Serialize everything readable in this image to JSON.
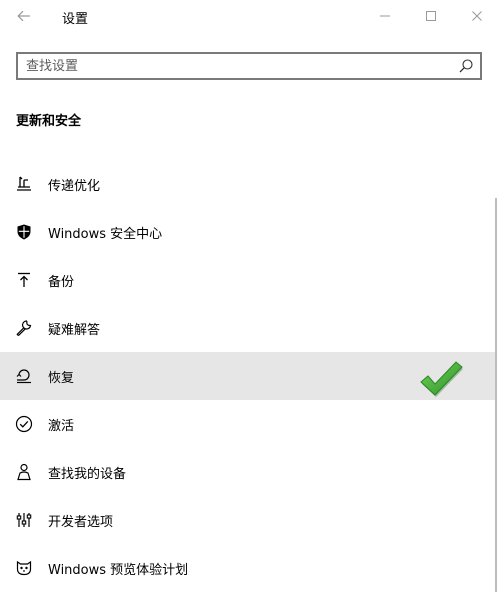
{
  "window": {
    "title": "设置"
  },
  "search": {
    "placeholder": "查找设置",
    "value": ""
  },
  "section": {
    "heading": "更新和安全"
  },
  "nav": {
    "items": [
      {
        "label": "传递优化",
        "icon": "delivery-optimization-icon"
      },
      {
        "label": "Windows 安全中心",
        "icon": "shield-icon"
      },
      {
        "label": "备份",
        "icon": "backup-upload-icon"
      },
      {
        "label": "疑难解答",
        "icon": "wrench-icon"
      },
      {
        "label": "恢复",
        "icon": "recovery-icon",
        "selected": true
      },
      {
        "label": "激活",
        "icon": "check-circle-icon"
      },
      {
        "label": "查找我的设备",
        "icon": "person-location-icon"
      },
      {
        "label": "开发者选项",
        "icon": "developer-tools-icon"
      },
      {
        "label": "Windows 预览体验计划",
        "icon": "insider-cat-icon"
      }
    ]
  },
  "colors": {
    "selected_bg": "#e6e6e6",
    "check_green": "#3aa52f"
  }
}
